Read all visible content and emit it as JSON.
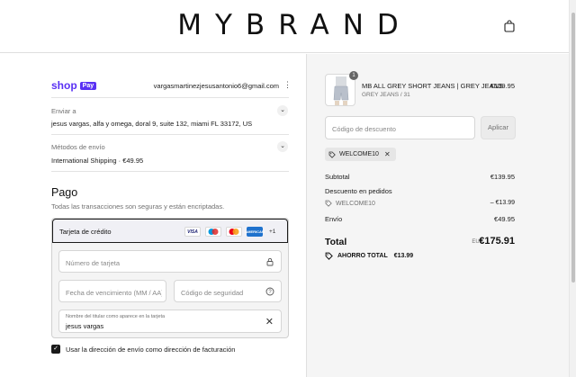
{
  "header": {
    "brand": "MYBRAND",
    "cart_icon": "shopping-bag-icon"
  },
  "express": {
    "shop_word": "shop",
    "pay_badge": "Pay",
    "email": "vargasmartinezjesusantonio6@gmail.com",
    "menu_icon": "kebab-icon"
  },
  "shipping_address": {
    "label": "Enviar a",
    "value": "jesus vargas, alfa y omega, doral 9, suite 132, miami FL 33172, US"
  },
  "shipping_method": {
    "label": "Métodos de envío",
    "value": "International Shipping · €49.95"
  },
  "payment": {
    "title": "Pago",
    "subtitle": "Todas las transacciones son seguras y están encriptadas.",
    "method_label": "Tarjeta de crédito",
    "card_logos": [
      "VISA",
      "Maestro",
      "Mastercard",
      "AMEX"
    ],
    "more_logos": "+1",
    "card_number_placeholder": "Número de tarjeta",
    "expiry_placeholder": "Fecha de vencimiento (MM / AA)",
    "cvv_placeholder": "Código de seguridad",
    "name_label": "Nombre del titular como aparece en la tarjeta",
    "name_value": "jesus vargas",
    "billing_checkbox_label": "Usar la dirección de envío como dirección de facturación",
    "billing_checked": true
  },
  "order": {
    "product_name": "MB ALL GREY SHORT JEANS | GREY JEANS",
    "product_variant": "GREY JEANS / 31",
    "product_price": "€139.95",
    "quantity": "1",
    "discount_placeholder": "Código de descuento",
    "apply_label": "Aplicar",
    "applied_code": "WELCOME10",
    "subtotal_label": "Subtotal",
    "subtotal_value": "€139.95",
    "order_discount_label": "Descuento en pedidos",
    "discount_code": "WELCOME10",
    "discount_value": "– €13.99",
    "shipping_label": "Envío",
    "shipping_value": "€49.95",
    "total_label": "Total",
    "total_currency": "EUR",
    "total_value": "€175.91",
    "savings_label": "AHORRO TOTAL",
    "savings_value": "€13.99"
  },
  "colors": {
    "shop_pay": "#5a31f4",
    "summary_bg": "#f5f5f5"
  }
}
